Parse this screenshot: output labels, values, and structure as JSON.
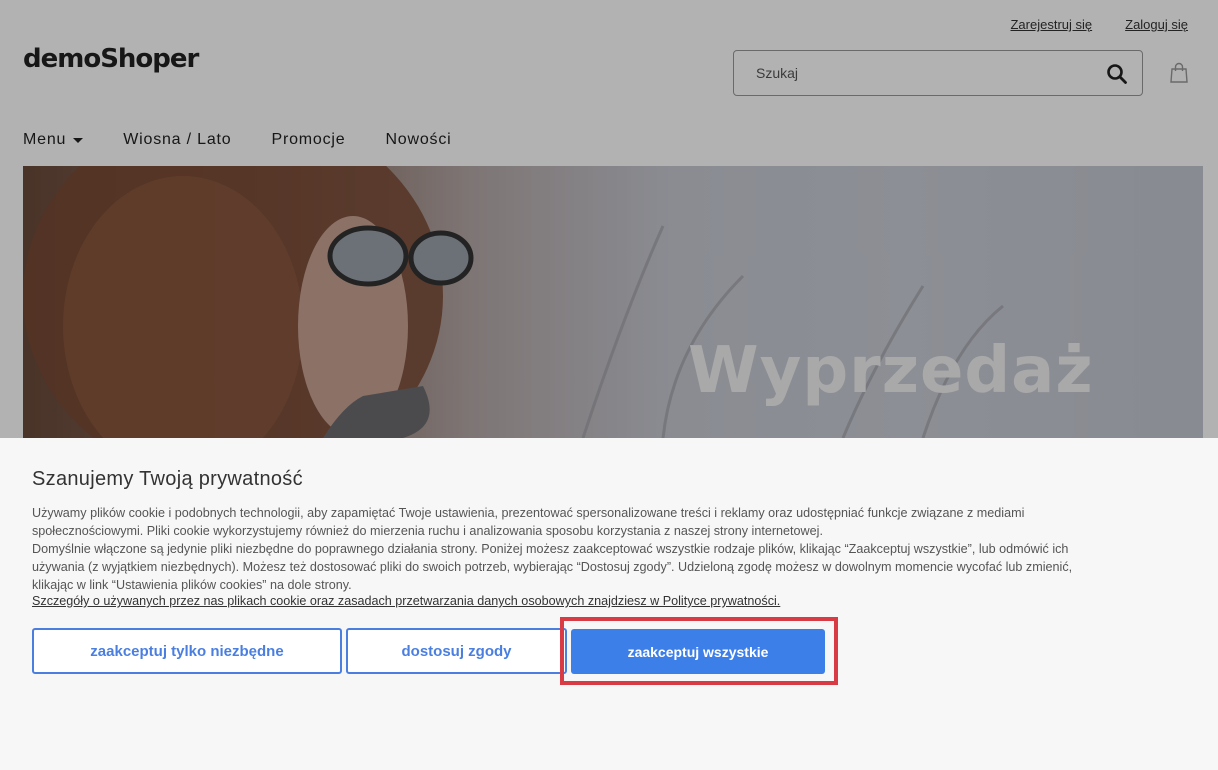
{
  "header": {
    "logo": "demoShoper",
    "register_link": "Zarejestruj się",
    "login_link": "Zaloguj się",
    "search_placeholder": "Szukaj",
    "search_icon": "search-icon",
    "cart_icon": "shopping-bag-icon"
  },
  "nav": {
    "items": [
      {
        "label": "Menu",
        "has_dropdown": true
      },
      {
        "label": "Wiosna / Lato"
      },
      {
        "label": "Promocje"
      },
      {
        "label": "Nowości"
      }
    ]
  },
  "hero": {
    "title": "Wyprzedaż"
  },
  "cookie_banner": {
    "title": "Szanujemy Twoją prywatność",
    "paragraph_1": "Używamy plików cookie i podobnych technologii, aby zapamiętać Twoje ustawienia, prezentować spersonalizowane treści i reklamy oraz udostępniać funkcje związane z mediami społecznościowymi. Pliki cookie wykorzystujemy również do mierzenia ruchu i analizowania sposobu korzystania z naszej strony internetowej.",
    "paragraph_2": "Domyślnie włączone są jedynie pliki niezbędne do poprawnego działania strony. Poniżej możesz  zaakceptować wszystkie rodzaje plików, klikając “Zaakceptuj wszystkie”, lub odmówić ich używania (z wyjątkiem niezbędnych). Możesz też dostosować pliki do swoich potrzeb, wybierając “Dostosuj zgody”. Udzieloną zgodę możesz w dowolnym momencie wycofać lub zmienić, klikając w link “Ustawienia plików cookies” na dole strony.",
    "policy_link": "Szczegóły o używanych przez nas plikach cookie oraz zasadach przetwarzania danych osobowych znajdziesz w Polityce prywatności.",
    "btn_necessary": "zaakceptuj tylko niezbędne",
    "btn_customize": "dostosuj zgody",
    "btn_accept_all": "zaakceptuj wszystkie"
  },
  "colors": {
    "accent": "#3d7fe8",
    "highlight": "#d93b45"
  }
}
